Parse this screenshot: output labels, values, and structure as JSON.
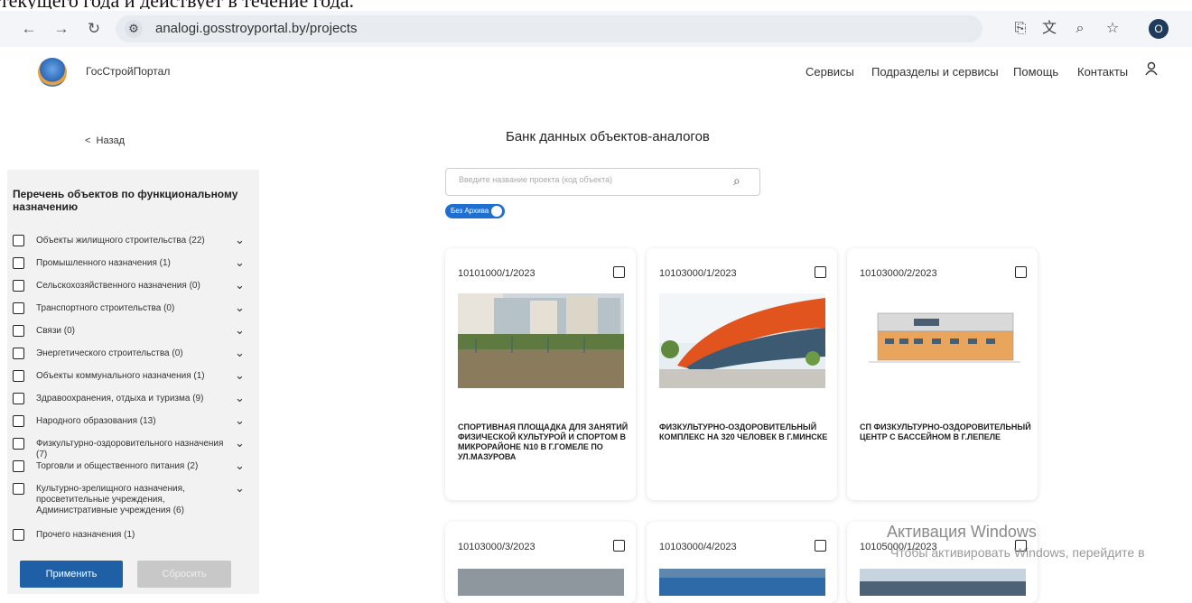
{
  "top_fragment": "текущего года и действует в течение года.",
  "browser": {
    "url": "analogi.gosstroyportal.by/projects",
    "profile_letter": "O",
    "icons": [
      "back-arrow-icon",
      "forward-arrow-icon",
      "reload-icon",
      "site-info-icon",
      "cast-icon",
      "translate-icon",
      "zoom-icon",
      "star-icon"
    ]
  },
  "header": {
    "brand": "ГосСтройПортал",
    "nav": [
      "Сервисы",
      "Подразделы и сервисы",
      "Помощь",
      "Контакты"
    ],
    "user_icon": "user-icon"
  },
  "page": {
    "back_label": "Назад",
    "title": "Банк данных объектов-аналогов",
    "search_placeholder": "Введите название проекта (код объекта)",
    "toggle_label": "Без Архива",
    "toggle_on": true
  },
  "sidebar": {
    "title": "Перечень объектов по функциональному назначению",
    "categories": [
      {
        "label": "Объекты жилищного строительства (22)",
        "has_chevron": true
      },
      {
        "label": "Промышленного назначения (1)",
        "has_chevron": true
      },
      {
        "label": "Сельскохозяйственного назначения (0)",
        "has_chevron": true
      },
      {
        "label": "Транспортного строительства (0)",
        "has_chevron": true
      },
      {
        "label": "Связи (0)",
        "has_chevron": true
      },
      {
        "label": "Энергетического строительства (0)",
        "has_chevron": true
      },
      {
        "label": "Объекты коммунального назначения (1)",
        "has_chevron": true
      },
      {
        "label": "Здравоохранения, отдыха и туризма (9)",
        "has_chevron": true
      },
      {
        "label": "Народного образования (13)",
        "has_chevron": true
      },
      {
        "label": "Физкультурно-оздоровительного назначения (7)",
        "has_chevron": true
      },
      {
        "label": "Торговли и общественного питания (2)",
        "has_chevron": true
      },
      {
        "label": "Культурно-зрелищного назначения, просветительные учреждения, Административные учреждения (6)",
        "has_chevron": true
      },
      {
        "label": "Прочего назначения (1)",
        "has_chevron": false
      }
    ],
    "apply_label": "Применить",
    "reset_label": "Сбросить"
  },
  "cards": [
    {
      "code": "10101000/1/2023",
      "title": "СПОРТИВНАЯ ПЛОЩАДКА ДЛЯ ЗАНЯТИЙ ФИЗИЧЕСКОЙ КУЛЬТУРОЙ И СПОРТОМ В МИКРОРАЙОНЕ N10 В Г.ГОМЕЛЕ ПО УЛ.МАЗУРОВА"
    },
    {
      "code": "10103000/1/2023",
      "title": "ФИЗКУЛЬТУРНО-ОЗДОРОВИТЕЛЬНЫЙ КОМПЛЕКС НА 320 ЧЕЛОВЕК В Г.МИНСКЕ"
    },
    {
      "code": "10103000/2/2023",
      "title": "СП ФИЗКУЛЬТУРНО-ОЗДОРОВИТЕЛЬНЫЙ ЦЕНТР С БАССЕЙНОМ В Г.ЛЕПЕЛЕ"
    },
    {
      "code": "10103000/3/2023",
      "title": ""
    },
    {
      "code": "10103000/4/2023",
      "title": ""
    },
    {
      "code": "10105000/1/2023",
      "title": ""
    }
  ],
  "watermark": {
    "line1": "Активация Windows",
    "line2": "Чтобы активировать Windows, перейдите в"
  }
}
